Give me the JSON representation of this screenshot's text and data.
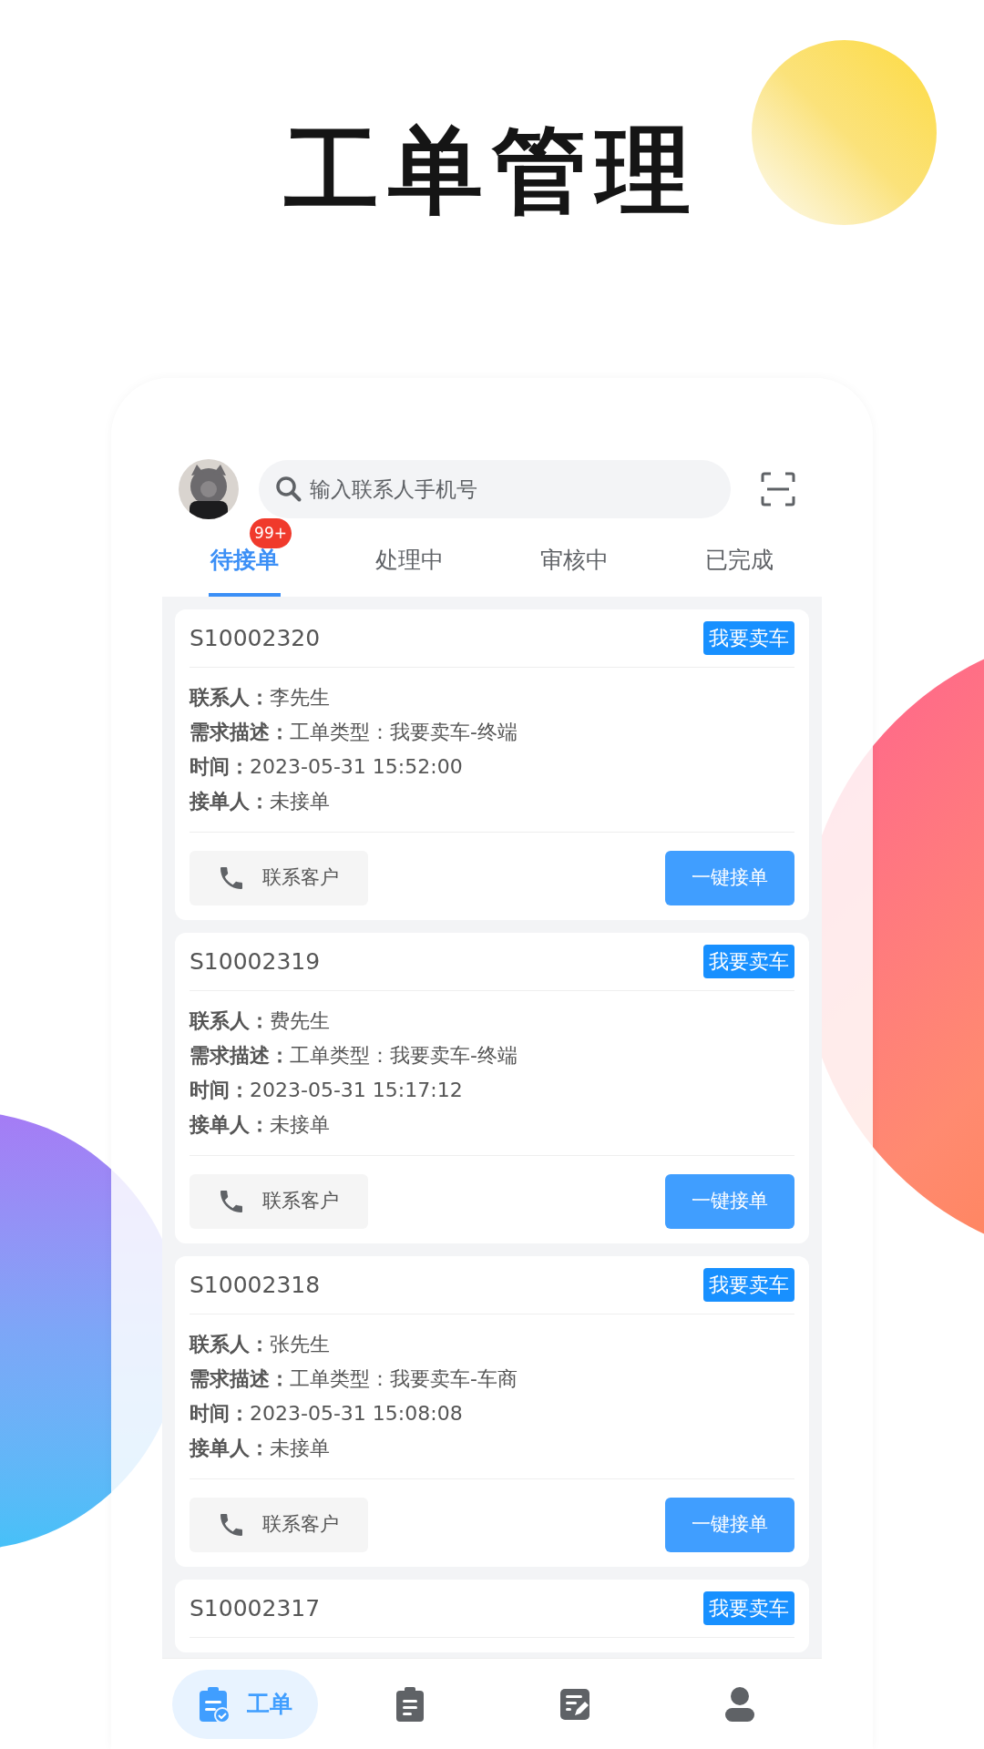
{
  "title": "工单管理",
  "search": {
    "placeholder": "输入联系人手机号"
  },
  "tabs": [
    {
      "label": "待接单",
      "selected": true,
      "badge": "99+"
    },
    {
      "label": "处理中",
      "selected": false
    },
    {
      "label": "审核中",
      "selected": false
    },
    {
      "label": "已完成",
      "selected": false
    }
  ],
  "orders": [
    {
      "id": "S10002320",
      "tag": "我要卖车",
      "fields": [
        {
          "label": "联系人：",
          "value": "李先生"
        },
        {
          "label": "需求描述：",
          "value": "工单类型：我要卖车-终端"
        },
        {
          "label": "时间：",
          "value": "2023-05-31 15:52:00"
        },
        {
          "label": "接单人：",
          "value": "未接单"
        }
      ],
      "contact": "联系客户",
      "accept": "一键接单"
    },
    {
      "id": "S10002319",
      "tag": "我要卖车",
      "fields": [
        {
          "label": "联系人：",
          "value": "费先生"
        },
        {
          "label": "需求描述：",
          "value": "工单类型：我要卖车-终端"
        },
        {
          "label": "时间：",
          "value": "2023-05-31 15:17:12"
        },
        {
          "label": "接单人：",
          "value": "未接单"
        }
      ],
      "contact": "联系客户",
      "accept": "一键接单"
    },
    {
      "id": "S10002318",
      "tag": "我要卖车",
      "fields": [
        {
          "label": "联系人：",
          "value": "张先生"
        },
        {
          "label": "需求描述：",
          "value": "工单类型：我要卖车-车商"
        },
        {
          "label": "时间：",
          "value": "2023-05-31 15:08:08"
        },
        {
          "label": "接单人：",
          "value": "未接单"
        }
      ],
      "contact": "联系客户",
      "accept": "一键接单"
    },
    {
      "id": "S10002317",
      "tag": "我要卖车"
    }
  ],
  "nav": [
    {
      "kind": "clipboard-check",
      "label": "工单",
      "selected": true
    },
    {
      "kind": "clipboard-list",
      "selected": false
    },
    {
      "kind": "edit",
      "selected": false
    },
    {
      "kind": "user",
      "selected": false
    }
  ]
}
